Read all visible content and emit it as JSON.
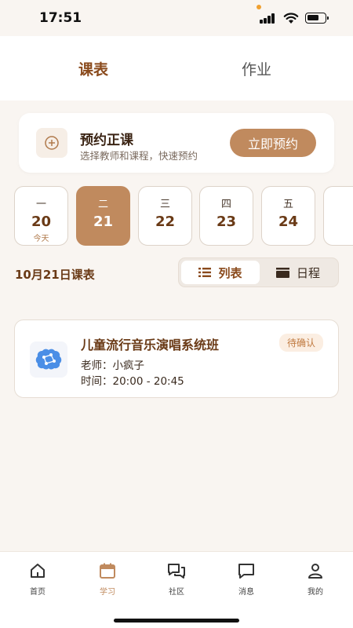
{
  "status_bar": {
    "time": "17:51"
  },
  "top_tabs": {
    "active": "课表",
    "inactive": "作业"
  },
  "booking": {
    "title": "预约正课",
    "subtitle": "选择教师和课程，快速预约",
    "button": "立即预约",
    "icon": "plus-circle-icon"
  },
  "days": [
    {
      "weekday": "一",
      "date": "20",
      "note": "今天"
    },
    {
      "weekday": "二",
      "date": "21",
      "selected": true
    },
    {
      "weekday": "三",
      "date": "22"
    },
    {
      "weekday": "四",
      "date": "23"
    },
    {
      "weekday": "五",
      "date": "24"
    }
  ],
  "schedule": {
    "title": "10月21日课表",
    "view_list": "列表",
    "view_calendar": "日程"
  },
  "course": {
    "name": "儿童流行音乐演唱系统班",
    "status": "待确认",
    "teacher": "老师：小疯子",
    "time": "时间：20:00 - 20:45",
    "logo_icon": "brain-icon"
  },
  "nav": {
    "home": "首页",
    "study": "学习",
    "community": "社区",
    "messages": "消息",
    "mine": "我的"
  },
  "colors": {
    "accent": "#c08a5e",
    "accent_dark": "#8a4a1c",
    "background": "#f9f5f1"
  }
}
